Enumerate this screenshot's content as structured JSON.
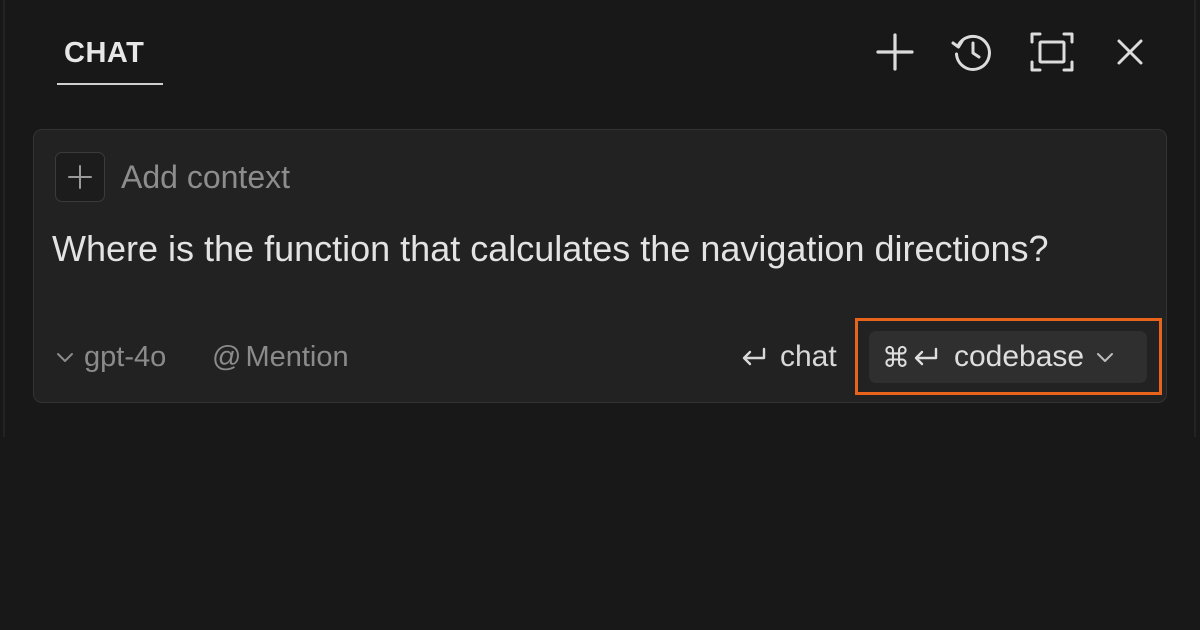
{
  "header": {
    "tab_label": "CHAT",
    "icons": [
      "plus-icon",
      "history-icon",
      "maximize-icon",
      "close-icon"
    ]
  },
  "composer": {
    "add_context_label": "Add context",
    "prompt_text": "Where is the function that calculates the navigation directions?",
    "model_label": "gpt-4o",
    "mention_symbol": "@",
    "mention_label": "Mention",
    "chat_label": "chat",
    "codebase_shortcut": "⌘",
    "codebase_label": "codebase"
  },
  "colors": {
    "background": "#181818",
    "card": "#222222",
    "highlight": "#e8641c"
  }
}
